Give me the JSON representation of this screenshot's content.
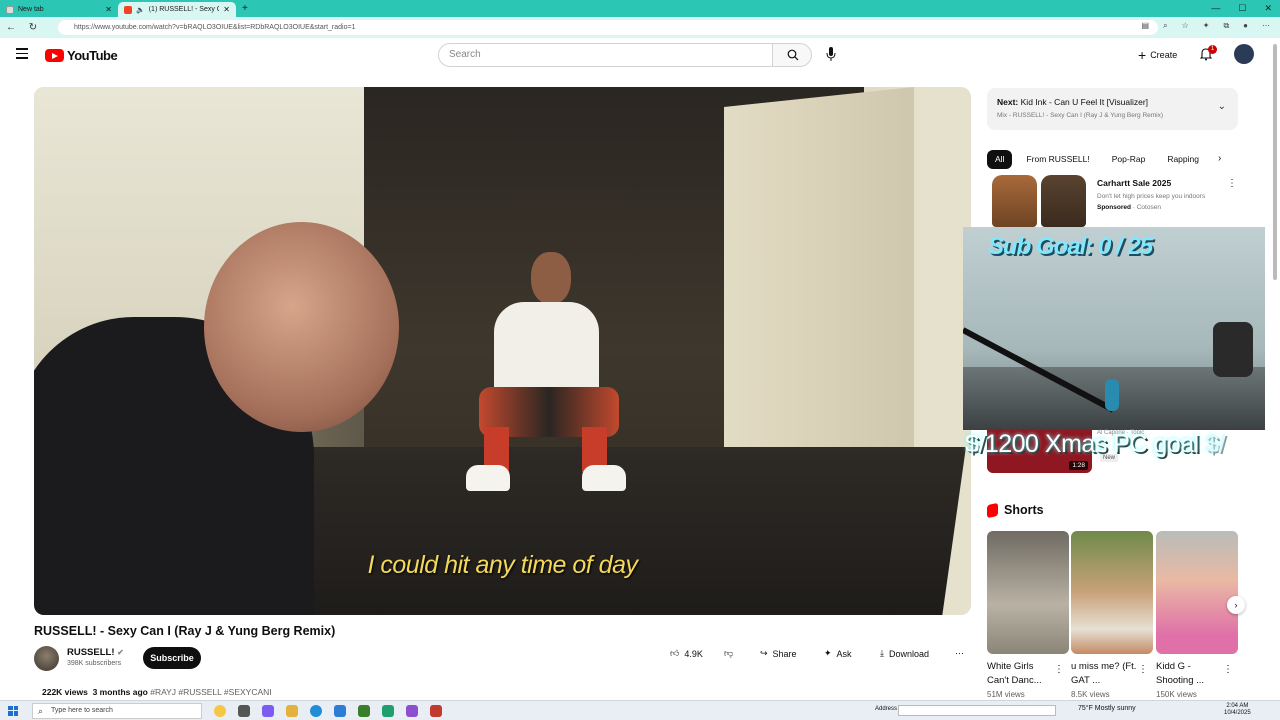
{
  "browser": {
    "tabs": [
      {
        "label": "New tab"
      },
      {
        "label": "(1) RUSSELL! - Sexy Can I (Ra"
      }
    ],
    "url": "https://www.youtube.com/watch?v=bRAQLO3OIUE&list=RDbRAQLO3OIUE&start_radio=1"
  },
  "header": {
    "logo_text": "YouTube",
    "search_placeholder": "Search",
    "create_label": "Create",
    "notification_count": "1"
  },
  "video": {
    "subtitle": "I could hit any time of day",
    "title": "RUSSELL! - Sexy Can I (Ray J & Yung Berg Remix)",
    "channel": "RUSSELL!",
    "subscribers": "398K subscribers",
    "subscribe_label": "Subscribe",
    "likes": "4.9K",
    "share_label": "Share",
    "ask_label": "Ask",
    "download_label": "Download",
    "views": "222K views",
    "age": "3 months ago",
    "tags": "#RAYJ #RUSSELL #SEXYCANI"
  },
  "sidebar": {
    "next_prefix": "Next:",
    "next_title": "Kid Ink - Can U Feel It [Visualizer]",
    "next_sub": "Mix - RUSSELL! - Sexy Can I (Ray J & Yung Berg Remix)",
    "chips": [
      "All",
      "From RUSSELL!",
      "Pop-Rap",
      "Rapping"
    ],
    "ad": {
      "title": "Carhartt Sale 2025",
      "desc": "Don't let high prices keep you indoors",
      "sponsored": "Sponsored",
      "advertiser": "Cotosen"
    },
    "overlay_goal": "Sub Goal:  0 / 25",
    "overlay_xmas": "$/1200 Xmas PC goal",
    "overlay_xmas_tail": "$/",
    "rec": {
      "duration": "1:28",
      "meta": "Al Capone · Topic",
      "badge": "New"
    },
    "shorts_heading": "Shorts",
    "shorts": [
      {
        "title": "White Girls Can't Danc...",
        "views": "51M views"
      },
      {
        "title": "u miss me? (Ft. GAT ...",
        "views": "8.5K views"
      },
      {
        "title": "Kidd G - Shooting ...",
        "views": "150K views"
      }
    ]
  },
  "taskbar": {
    "search_placeholder": "Type here to search",
    "address_label": "Address",
    "weather": "75°F  Mostly sunny",
    "time": "2:04 AM",
    "date": "10/4/2025"
  }
}
